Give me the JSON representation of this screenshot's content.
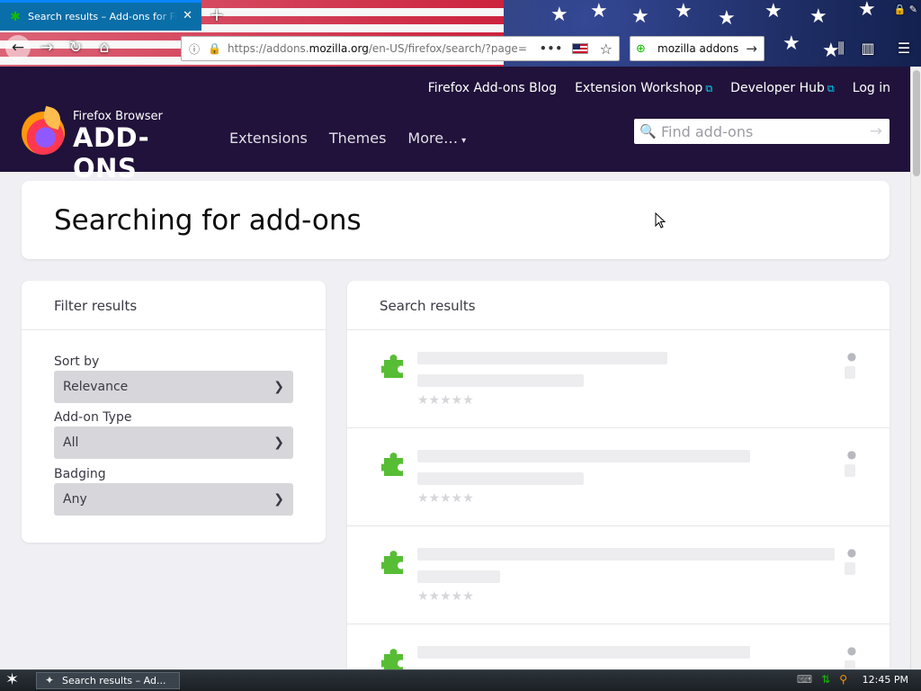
{
  "browser": {
    "tab": {
      "title": "Search results – Add-ons for Firefox",
      "favicon": "puzzle-icon"
    },
    "new_tab": "+",
    "url": {
      "prefix": "https://addons.",
      "host": "mozilla.org",
      "path": "/en-US/firefox/search/?page="
    },
    "search_query": "mozilla addons",
    "icons": {
      "more": "•••",
      "bookmark": "☆",
      "go": "→"
    }
  },
  "amo": {
    "top_links": [
      {
        "label": "Firefox Add-ons Blog",
        "external": false
      },
      {
        "label": "Extension Workshop",
        "external": true
      },
      {
        "label": "Developer Hub",
        "external": true
      },
      {
        "label": "Log in",
        "external": false
      }
    ],
    "logo": {
      "line1": "Firefox Browser",
      "line2": "ADD-ONS"
    },
    "nav": {
      "extensions": "Extensions",
      "themes": "Themes",
      "more": "More…"
    },
    "search": {
      "placeholder": "Find add-ons"
    }
  },
  "heading": "Searching for add-ons",
  "filters": {
    "title": "Filter results",
    "sort_by": {
      "label": "Sort by",
      "value": "Relevance"
    },
    "addon_type": {
      "label": "Add-on Type",
      "value": "All"
    },
    "badging": {
      "label": "Badging",
      "value": "Any"
    }
  },
  "results": {
    "title": "Search results",
    "loading_items": 4,
    "rating_stars": "★★★★★"
  },
  "taskbar": {
    "task_label": "Search results – Ad...",
    "time": "12:45 PM"
  },
  "colors": {
    "amo_header": "#20123a",
    "link_accent": "#00ddff",
    "addon_icon": "#57bd35",
    "skeleton": "#ededf0"
  }
}
